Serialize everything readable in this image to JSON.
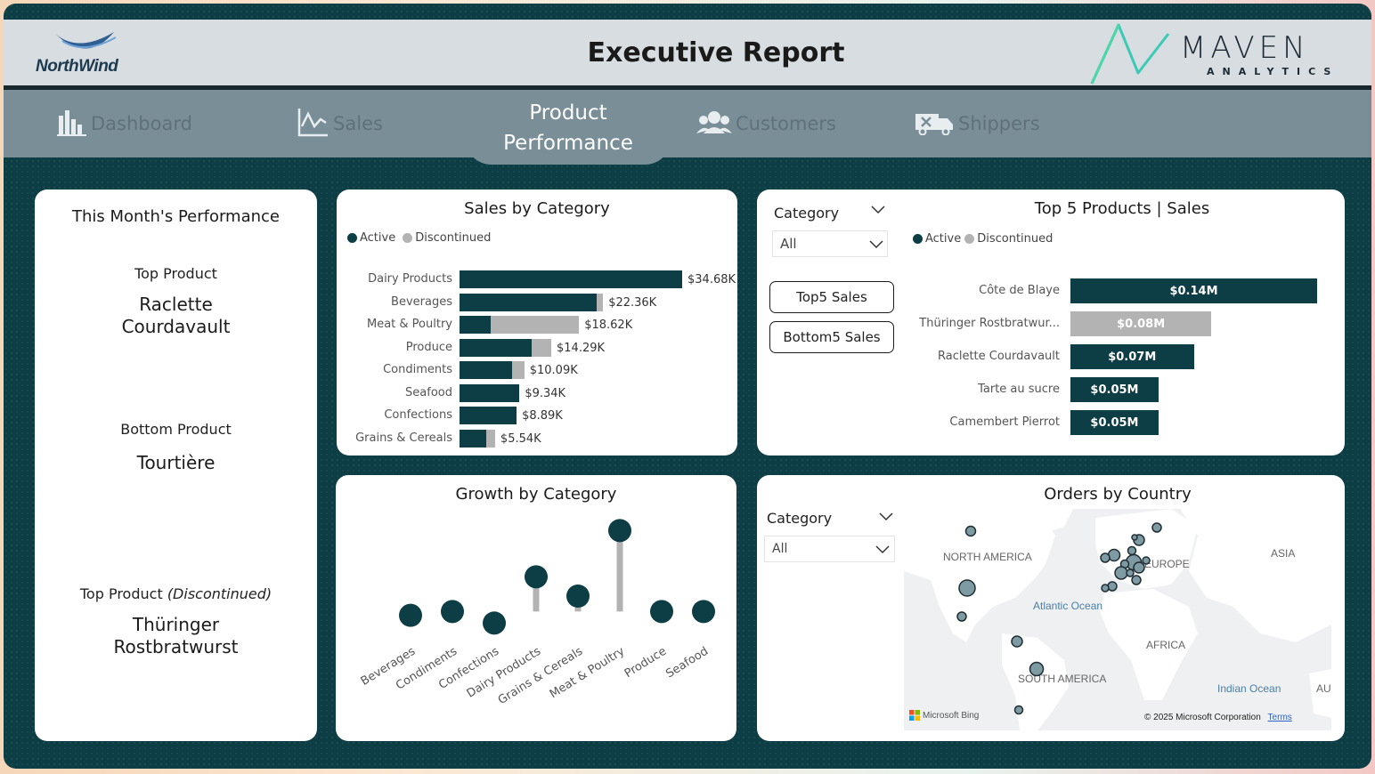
{
  "header": {
    "title": "Executive Report",
    "left_logo_text": "NorthWind",
    "right_logo_main": "MAVEN",
    "right_logo_sub": "ANALYTICS"
  },
  "nav": {
    "items": [
      {
        "label": "Dashboard",
        "icon": "bar-chart-icon"
      },
      {
        "label": "Sales",
        "icon": "line-chart-icon"
      },
      {
        "label": "Product Performance",
        "icon": "",
        "active": true
      },
      {
        "label": "Customers",
        "icon": "users-icon"
      },
      {
        "label": "Shippers",
        "icon": "truck-icon"
      }
    ],
    "active_line1": "Product",
    "active_line2": "Performance"
  },
  "performance": {
    "title": "This Month's Performance",
    "top_product_label": "Top Product",
    "top_product_line1": "Raclette",
    "top_product_line2": "Courdavault",
    "bottom_product_label": "Bottom Product",
    "bottom_product": "Tourtière",
    "top_discontinued_label": "Top Product",
    "top_discontinued_tag": "(Discontinued)",
    "top_discontinued_line1": "Thüringer",
    "top_discontinued_line2": "Rostbratwurst"
  },
  "legend": {
    "active": "Active",
    "discontinued": "Discontinued",
    "active_color": "#0d3d45",
    "discontinued_color": "#b3b3b3"
  },
  "sales_by_category": {
    "title": "Sales by Category",
    "chart_data": {
      "type": "bar",
      "orientation": "horizontal",
      "stacked": true,
      "categories": [
        "Dairy Products",
        "Beverages",
        "Meat & Poultry",
        "Produce",
        "Condiments",
        "Seafood",
        "Confections",
        "Grains & Cereals"
      ],
      "series": [
        {
          "name": "Active",
          "values": [
            34.68,
            21.4,
            4.8,
            11.3,
            8.2,
            9.34,
            8.89,
            4.2
          ]
        },
        {
          "name": "Discontinued",
          "values": [
            0,
            0.96,
            13.82,
            2.99,
            1.89,
            0,
            0,
            1.34
          ]
        }
      ],
      "totals": [
        34.68,
        22.36,
        18.62,
        14.29,
        10.09,
        9.34,
        8.89,
        5.54
      ],
      "data_labels": [
        "$34.68K",
        "$22.36K",
        "$18.62K",
        "$14.29K",
        "$10.09K",
        "$9.34K",
        "$8.89K",
        "$5.54K"
      ],
      "unit": "K USD"
    }
  },
  "top5": {
    "title": "Top 5 Products | Sales",
    "slicer_label": "Category",
    "slicer_value": "All",
    "button_top": "Top5 Sales",
    "button_bottom": "Bottom5 Sales",
    "chart_data": {
      "type": "bar",
      "orientation": "horizontal",
      "categories": [
        "Côte de Blaye",
        "Thüringer Rostbratwur...",
        "Raclette Courdavault",
        "Tarte au sucre",
        "Camembert Pierrot"
      ],
      "values": [
        0.14,
        0.08,
        0.07,
        0.05,
        0.05
      ],
      "status": [
        "Active",
        "Discontinued",
        "Active",
        "Active",
        "Active"
      ],
      "data_labels": [
        "$0.14M",
        "$0.08M",
        "$0.07M",
        "$0.05M",
        "$0.05M"
      ],
      "unit": "M USD"
    }
  },
  "growth": {
    "title": "Growth by Category",
    "chart_data": {
      "type": "scatter",
      "style": "lollipop",
      "categories": [
        "Beverages",
        "Condiments",
        "Confections",
        "Dairy Products",
        "Grains & Cereals",
        "Meat & Poultry",
        "Produce",
        "Seafood"
      ],
      "values": [
        -0.01,
        0.0,
        -0.03,
        0.09,
        0.04,
        0.21,
        0.0,
        0.0
      ],
      "ylim": [
        -0.05,
        0.25
      ]
    }
  },
  "orders_by_country": {
    "title": "Orders by Country",
    "slicer_label": "Category",
    "slicer_value": "All",
    "map_labels": {
      "north_america": "NORTH AMERICA",
      "europe": "EUROPE",
      "asia": "ASIA",
      "africa": "AFRICA",
      "south_america": "SOUTH AMERICA",
      "au": "AU",
      "atlantic": "Atlantic Ocean",
      "indian": "Indian Ocean"
    },
    "attribution_brand": "Microsoft Bing",
    "attribution_copy": "© 2025 Microsoft Corporation",
    "attribution_terms": "Terms"
  }
}
